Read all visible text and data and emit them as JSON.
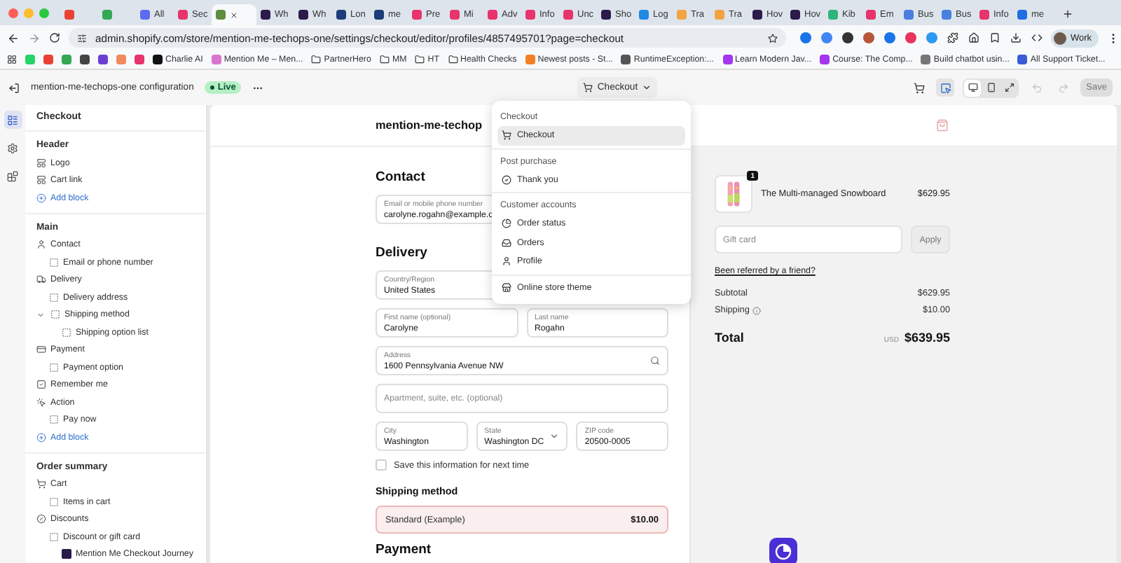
{
  "browser": {
    "tabs": [
      {
        "color": "#e94235",
        "selected": false
      },
      {
        "color": "#34a853",
        "selected": false
      },
      {
        "label": "All",
        "color": "#5b6cf0",
        "selected": false
      },
      {
        "label": "Sec",
        "color": "#e8336d",
        "selected": false
      },
      {
        "color": "#5e8e3e",
        "selected": true
      },
      {
        "label": "Wh",
        "color": "#2a1b4a",
        "selected": false
      },
      {
        "label": "Wh",
        "color": "#2a1b4a",
        "selected": false
      },
      {
        "label": "Lon",
        "color": "#1d3c78",
        "selected": false
      },
      {
        "label": "me",
        "color": "#1d3c78",
        "selected": false
      },
      {
        "label": "Pre",
        "color": "#e8336d",
        "selected": false
      },
      {
        "label": "Mi",
        "color": "#e8336d",
        "selected": false
      },
      {
        "label": "Adv",
        "color": "#e8336d",
        "selected": false
      },
      {
        "label": "Info",
        "color": "#e8336d",
        "selected": false
      },
      {
        "label": "Unc",
        "color": "#e8336d",
        "selected": false
      },
      {
        "label": "Sho",
        "color": "#2a1b4a",
        "selected": false
      },
      {
        "label": "Log",
        "color": "#1e88e5",
        "selected": false
      },
      {
        "label": "Tra",
        "color": "#f4a340",
        "selected": false
      },
      {
        "label": "Tra",
        "color": "#f4a340",
        "selected": false
      },
      {
        "label": "Hov",
        "color": "#2a1b4a",
        "selected": false
      },
      {
        "label": "Hov",
        "color": "#2a1b4a",
        "selected": false
      },
      {
        "label": "Kib",
        "color": "#2fb37c",
        "selected": false
      },
      {
        "label": "Em",
        "color": "#e8336d",
        "selected": false
      },
      {
        "label": "Bus",
        "color": "#4a7fe0",
        "selected": false
      },
      {
        "label": "Bus",
        "color": "#4a7fe0",
        "selected": false
      },
      {
        "label": "Info",
        "color": "#e8336d",
        "selected": false
      },
      {
        "label": "me",
        "color": "#1e6fe0",
        "selected": false
      }
    ],
    "address": "admin.shopify.com/store/mention-me-techops-one/settings/checkout/editor/profiles/4857495701?page=checkout",
    "profile": "Work",
    "bookmarks": [
      {
        "kind": "site",
        "color": "#25d366"
      },
      {
        "kind": "site",
        "color": "#e94235"
      },
      {
        "kind": "site",
        "color": "#34a853"
      },
      {
        "kind": "site",
        "color": "#444444"
      },
      {
        "kind": "site",
        "color": "#6b3fd4"
      },
      {
        "kind": "site",
        "color": "#f08a5d"
      },
      {
        "kind": "site",
        "color": "#e8336d"
      },
      {
        "kind": "site",
        "label": "Charlie AI",
        "color": "#111111"
      },
      {
        "kind": "site",
        "label": "Mention Me – Men...",
        "color": "#d977d0"
      },
      {
        "kind": "folder",
        "label": "PartnerHero"
      },
      {
        "kind": "folder",
        "label": "MM"
      },
      {
        "kind": "folder",
        "label": "HT"
      },
      {
        "kind": "folder",
        "label": "Health Checks"
      },
      {
        "kind": "site",
        "label": "Newest posts - St...",
        "color": "#f48024"
      },
      {
        "kind": "site",
        "label": "RuntimeException:...",
        "color": "#555555"
      },
      {
        "kind": "site",
        "label": "Learn Modern Jav...",
        "color": "#a435f0"
      },
      {
        "kind": "site",
        "label": "Course: The Comp...",
        "color": "#a435f0"
      },
      {
        "kind": "site",
        "label": "Build chatbot usin...",
        "color": "#777777"
      },
      {
        "kind": "site",
        "label": "All Support Ticket...",
        "color": "#3b5bdb"
      }
    ]
  },
  "app_bar": {
    "title": "mention-me-techops-one configuration",
    "status": "Live",
    "page_button": "Checkout",
    "select_tool_active": true,
    "view_modes": [
      {
        "kind": "desktop",
        "selected": true
      },
      {
        "kind": "mobile",
        "selected": false
      },
      {
        "kind": "fullscreen",
        "selected": false
      }
    ],
    "undo_disabled": true,
    "save": "Save",
    "save_disabled": true
  },
  "rail": [
    {
      "kind": "sections",
      "selected": true
    },
    {
      "kind": "settings",
      "selected": false
    },
    {
      "kind": "apps",
      "selected": false
    }
  ],
  "sidebar": {
    "title": "Checkout",
    "sections": [
      {
        "heading": "Header",
        "items": [
          {
            "label": "Logo",
            "kind": "layout"
          },
          {
            "label": "Cart link",
            "kind": "layout"
          },
          {
            "label": "Add block",
            "kind": "add"
          }
        ]
      },
      {
        "heading": "Main",
        "items": [
          {
            "label": "Contact",
            "kind": "user",
            "children": [
              {
                "label": "Email or phone number",
                "kind": "block"
              }
            ]
          },
          {
            "label": "Delivery",
            "kind": "truck",
            "children": [
              {
                "label": "Delivery address",
                "kind": "block"
              },
              {
                "label": "Shipping method",
                "kind": "block",
                "expanded": true,
                "children": [
                  {
                    "label": "Shipping option list",
                    "kind": "block"
                  }
                ]
              }
            ]
          },
          {
            "label": "Payment",
            "kind": "card",
            "children": [
              {
                "label": "Payment option",
                "kind": "block"
              }
            ]
          },
          {
            "label": "Remember me",
            "kind": "check"
          },
          {
            "label": "Action",
            "kind": "action",
            "children": [
              {
                "label": "Pay now",
                "kind": "block"
              }
            ]
          },
          {
            "label": "Add block",
            "kind": "add"
          }
        ]
      },
      {
        "heading": "Order summary",
        "items": [
          {
            "label": "Cart",
            "kind": "cart",
            "children": [
              {
                "label": "Items in cart",
                "kind": "block"
              }
            ]
          },
          {
            "label": "Discounts",
            "kind": "discount",
            "children": [
              {
                "label": "Discount or gift card",
                "kind": "block",
                "children": [
                  {
                    "label": "Mention Me Checkout Journey",
                    "kind": "app"
                  }
                ]
              }
            ]
          }
        ]
      }
    ]
  },
  "preview": {
    "store_name": "mention-me-techop",
    "contact": {
      "heading": "Contact",
      "rows": [
        [
          {
            "label": "Email or mobile phone number",
            "value": "carolyne.rogahn@example.c"
          }
        ]
      ]
    },
    "delivery": {
      "heading": "Delivery",
      "rows": [
        [
          {
            "label": "Country/Region",
            "value": "United States"
          }
        ],
        [
          {
            "label": "First name (optional)",
            "value": "Carolyne"
          },
          {
            "label": "Last name",
            "value": "Rogahn"
          }
        ],
        [
          {
            "label": "Address",
            "value": "1600 Pennsylvania Avenue NW",
            "kind": "search"
          }
        ],
        [
          {
            "placeholder": "Apartment, suite, etc. (optional)"
          }
        ],
        [
          {
            "label": "City",
            "value": "Washington"
          },
          {
            "label": "State",
            "value": "Washington DC",
            "kind": "select"
          },
          {
            "label": "ZIP code",
            "value": "20500-0005"
          }
        ]
      ],
      "save_info": {
        "label": "Save this information for next time",
        "checked": false
      }
    },
    "shipping": {
      "heading": "Shipping method",
      "option": {
        "label": "Standard (Example)",
        "price": "$10.00"
      }
    },
    "payment": {
      "heading": "Payment"
    },
    "summary": {
      "items": [
        {
          "name": "The Multi-managed Snowboard",
          "price": "$629.95",
          "quantity": "1"
        }
      ],
      "gift_card": {
        "placeholder": "Gift card",
        "button": "Apply"
      },
      "referral_link": "Been referred by a friend?",
      "lines": [
        {
          "label": "Subtotal",
          "value": "$629.95"
        },
        {
          "label": "Shipping",
          "value": "$10.00",
          "info": true
        }
      ],
      "total": {
        "label": "Total",
        "currency": "USD",
        "value": "$639.95"
      }
    }
  },
  "menu": {
    "groups": [
      {
        "heading": "Checkout",
        "items": [
          {
            "label": "Checkout",
            "kind": "cart",
            "selected": true
          }
        ]
      },
      {
        "heading": "Post purchase",
        "items": [
          {
            "label": "Thank you",
            "kind": "thanks",
            "selected": false
          }
        ]
      },
      {
        "heading": "Customer accounts",
        "items": [
          {
            "label": "Order status",
            "kind": "status",
            "selected": false
          },
          {
            "label": "Orders",
            "kind": "orders",
            "selected": false
          },
          {
            "label": "Profile",
            "kind": "profile",
            "selected": false
          }
        ]
      },
      {
        "items": [
          {
            "label": "Online store theme",
            "kind": "store",
            "selected": false
          }
        ]
      }
    ]
  }
}
